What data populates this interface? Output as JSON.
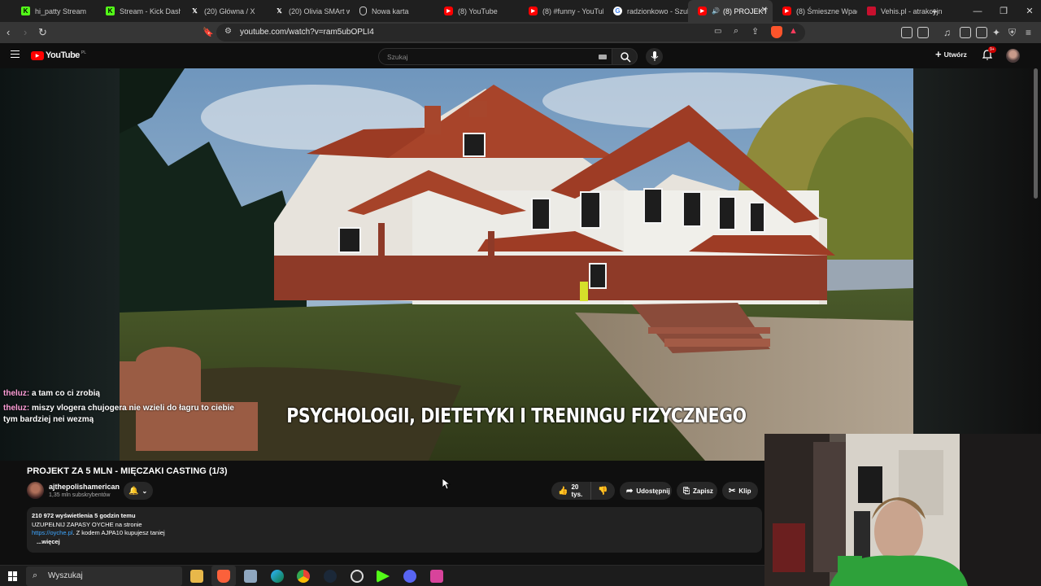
{
  "browser": {
    "tabs": [
      {
        "label": "hi_patty Stream",
        "icon": "kick-icon",
        "color": "#53fc18"
      },
      {
        "label": "Stream - Kick Dashb",
        "icon": "kick-icon",
        "color": "#53fc18"
      },
      {
        "label": "(20) Główna / X",
        "icon": "x-icon",
        "color": "#ffffff"
      },
      {
        "label": "(20) Olivia SMArt w",
        "icon": "x-icon",
        "color": "#ffffff"
      },
      {
        "label": "Nowa karta",
        "icon": "brave-shield-icon",
        "color": "#cccccc"
      },
      {
        "label": "(8) YouTube",
        "icon": "youtube-icon",
        "color": "#ff0000"
      },
      {
        "label": "(8) #funny - YouTub",
        "icon": "youtube-icon",
        "color": "#ff0000"
      },
      {
        "label": "radzionkowo - Szuk",
        "icon": "google-icon",
        "color": "#ffffff"
      },
      {
        "label": "(8) PROJEKT",
        "icon": "youtube-icon",
        "color": "#ff0000",
        "active": true
      },
      {
        "label": "(8) Śmieszne Wpadk",
        "icon": "youtube-icon",
        "color": "#ff0000"
      },
      {
        "label": "Vehis.pl - atrakcyjn",
        "icon": "vehis-icon",
        "color": "#c8102e"
      }
    ],
    "url": "youtube.com/watch?v=ram5ubOPLI4"
  },
  "youtube": {
    "logo_text": "YouTube",
    "logo_region": "PL",
    "search_placeholder": "Szukaj",
    "create_label": "Utwórz",
    "notification_count": "9+",
    "subtitle": "PSYCHOLOGII, DIETETYKI I TRENINGU FIZYCZNEGO",
    "video_title": "PROJEKT ZA 5 MLN - MIĘCZAKI CASTING (1/3)",
    "channel_name": "ajthepolishamerican",
    "subscribers": "1,35 mln subskrybentów",
    "like_count": "20 tys.",
    "share_label": "Udostępnij",
    "save_label": "Zapisz",
    "clip_label": "Klip",
    "description": {
      "stats": "210 972 wyświetlenia  5 godzin temu",
      "line1": "UZUPEŁNIJ ZAPASY OYCHE na stronie",
      "link": "https://oyche.pl",
      "line2_rest": ". Z kodem AJPA10 kupujesz taniej",
      "more": "...więcej"
    }
  },
  "chat": [
    {
      "user": "theluz:",
      "message": "a tam co ci zrobią"
    },
    {
      "user": "theluz:",
      "message": "miszy vlogera chujogera nie wzieli do łagru to ciebie tym bardziej nei wezmą"
    }
  ],
  "taskbar": {
    "search_placeholder": "Wyszukaj"
  }
}
